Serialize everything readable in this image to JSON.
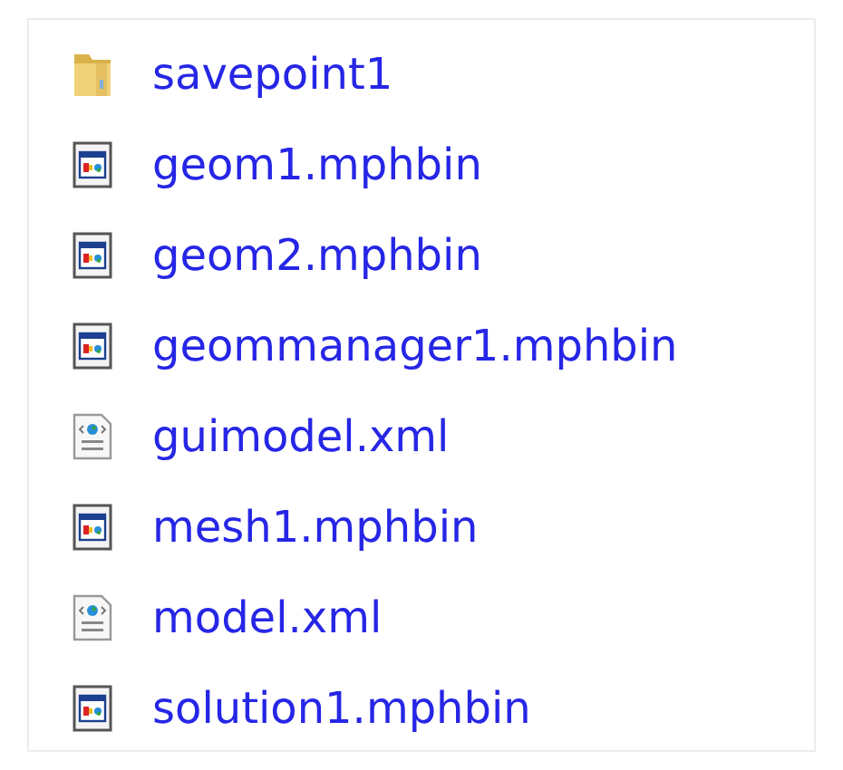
{
  "files": [
    {
      "name": "savepoint1",
      "kind": "folder"
    },
    {
      "name": "geom1.mphbin",
      "kind": "binary"
    },
    {
      "name": "geom2.mphbin",
      "kind": "binary"
    },
    {
      "name": "geommanager1.mphbin",
      "kind": "binary"
    },
    {
      "name": "guimodel.xml",
      "kind": "xml"
    },
    {
      "name": "mesh1.mphbin",
      "kind": "binary"
    },
    {
      "name": "model.xml",
      "kind": "xml"
    },
    {
      "name": "solution1.mphbin",
      "kind": "binary"
    }
  ]
}
